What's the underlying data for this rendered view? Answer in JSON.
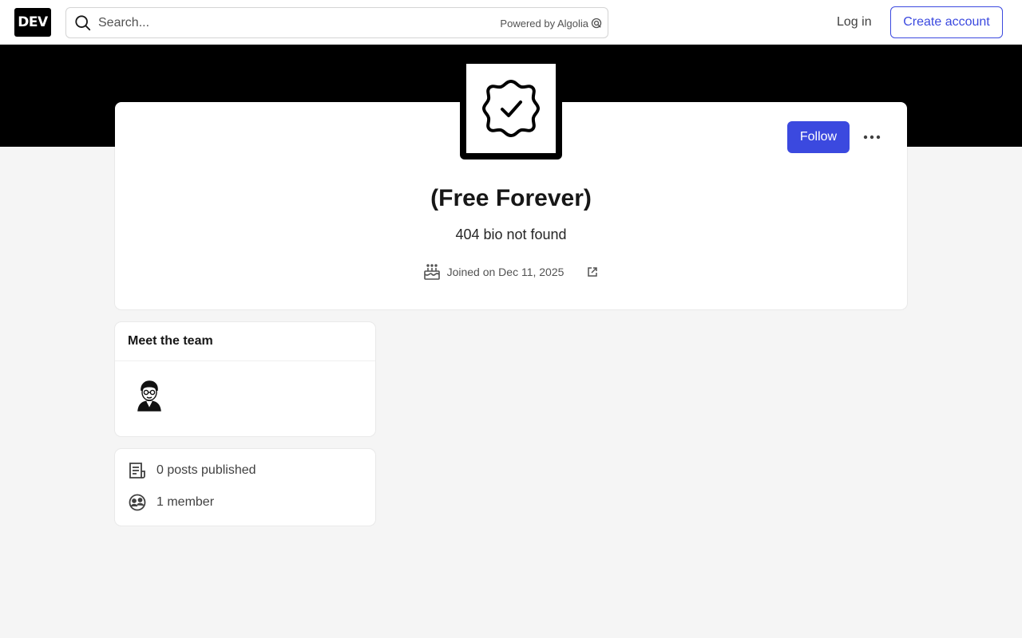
{
  "header": {
    "logo_text": "DEV",
    "search_placeholder": "Search...",
    "powered_by": "Powered by Algolia",
    "login_label": "Log in",
    "create_account_label": "Create account"
  },
  "profile": {
    "name": "(Free Forever)",
    "bio": "404 bio not found",
    "joined": "Joined on Dec 11, 2025",
    "follow_label": "Follow",
    "avatar_icon": "verified-badge-icon"
  },
  "team": {
    "title": "Meet the team",
    "members": [
      {
        "avatar_icon": "member-avatar-icon"
      }
    ]
  },
  "stats": {
    "posts": "0 posts published",
    "members": "1 member"
  },
  "colors": {
    "accent": "#3b49df",
    "banner": "#000000",
    "background": "#f5f5f5"
  }
}
